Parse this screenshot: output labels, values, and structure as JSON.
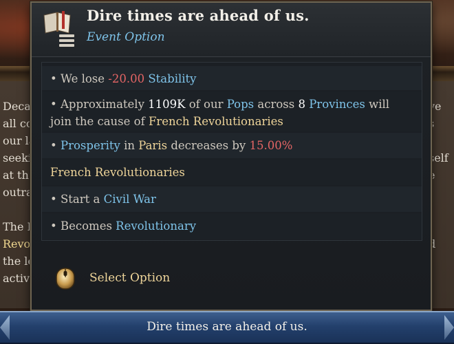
{
  "background": {
    "lines": [
      {
        "left": "Deca",
        "right": "ve"
      },
      {
        "left": "all co",
        "right": "s"
      },
      {
        "left": "our la",
        "right": ""
      },
      {
        "left": "seeki",
        "right": "self"
      },
      {
        "left": "at th",
        "right": "e"
      },
      {
        "left": "outra",
        "right": ""
      },
      {
        "left": "",
        "right": ""
      },
      {
        "left": "The R",
        "right": ""
      },
      {
        "left": "Revo",
        "right": "d"
      },
      {
        "left": "the lo",
        "right": "l"
      },
      {
        "left": "activ",
        "right": ""
      }
    ]
  },
  "tooltip": {
    "title": "Dire times are ahead of us.",
    "subtitle": "Event Option",
    "book_icon": "book-scroll-icon",
    "effects": [
      {
        "segments": [
          {
            "t": "• We lose ",
            "c": ""
          },
          {
            "t": "-20.00",
            "c": "neg"
          },
          {
            "t": " ",
            "c": ""
          },
          {
            "t": "Stability",
            "c": "blue"
          }
        ]
      },
      {
        "segments": [
          {
            "t": "• Approximately ",
            "c": ""
          },
          {
            "t": "1109K",
            "c": "white"
          },
          {
            "t": " of our ",
            "c": ""
          },
          {
            "t": "Pops",
            "c": "blue"
          },
          {
            "t": " across ",
            "c": ""
          },
          {
            "t": "8",
            "c": "white"
          },
          {
            "t": " ",
            "c": ""
          },
          {
            "t": "Provinces",
            "c": "blue"
          },
          {
            "t": " will join the cause of ",
            "c": ""
          },
          {
            "t": "French Revolutionaries",
            "c": "gold"
          }
        ]
      },
      {
        "segments": [
          {
            "t": "• ",
            "c": ""
          },
          {
            "t": "Prosperity",
            "c": "blue"
          },
          {
            "t": " in ",
            "c": ""
          },
          {
            "t": "Paris",
            "c": "gold"
          },
          {
            "t": " decreases by ",
            "c": ""
          },
          {
            "t": "15.00%",
            "c": "neg"
          }
        ]
      },
      {
        "segments": [
          {
            "t": "French Revolutionaries",
            "c": "gold"
          }
        ]
      },
      {
        "segments": [
          {
            "t": "• Start a ",
            "c": ""
          },
          {
            "t": "Civil War",
            "c": "blue"
          }
        ]
      },
      {
        "segments": [
          {
            "t": "• Becomes ",
            "c": ""
          },
          {
            "t": "Revolutionary",
            "c": "blue"
          }
        ]
      }
    ],
    "select_icon": "mouse-icon",
    "select_label": "Select Option"
  },
  "option_button": {
    "label": "Dire times are ahead of us."
  },
  "colors": {
    "negative": "#e56565",
    "link_blue": "#7fc4ea",
    "gold": "#efd59a",
    "button_blue": "#23406c"
  }
}
